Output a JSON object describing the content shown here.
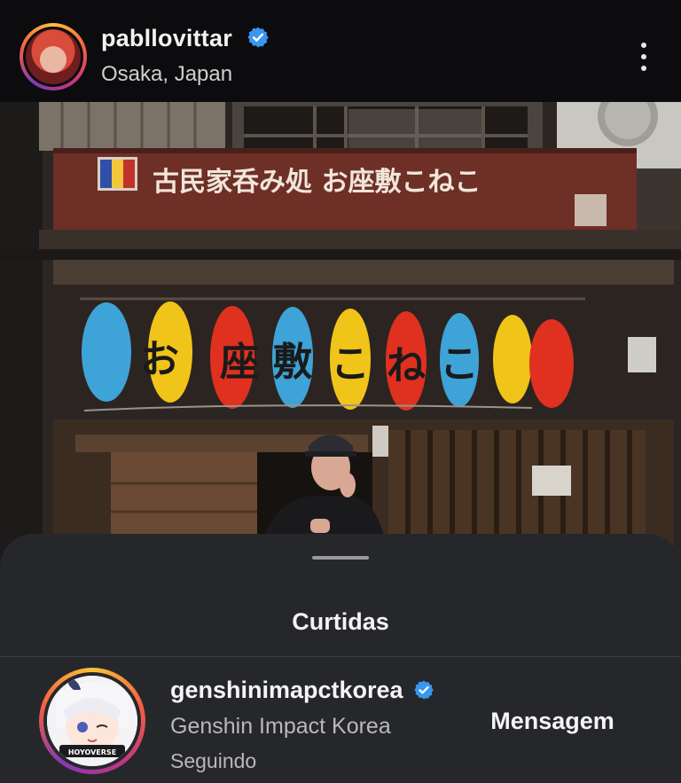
{
  "post": {
    "username": "pabllovittar",
    "location": "Osaka, Japan",
    "photo": {
      "sign_text": "古民家呑み処 お座敷こねこ",
      "lantern_glyphs": [
        "",
        "お",
        "座",
        "敷",
        "こ",
        "ね",
        "こ",
        "",
        ""
      ]
    }
  },
  "likes_sheet": {
    "title": "Curtidas",
    "items": [
      {
        "username": "genshinimapctkorea",
        "name": "Genshin Impact Korea",
        "status": "Seguindo",
        "action_label": "Mensagem",
        "avatar_badge": "HOYOVERSE"
      }
    ]
  },
  "colors": {
    "verified_blue": "#3897f0",
    "sheet_bg": "#26272b",
    "header_bg": "#0c0c0e"
  },
  "icons": [
    "verified-badge-icon",
    "more-options-icon"
  ]
}
